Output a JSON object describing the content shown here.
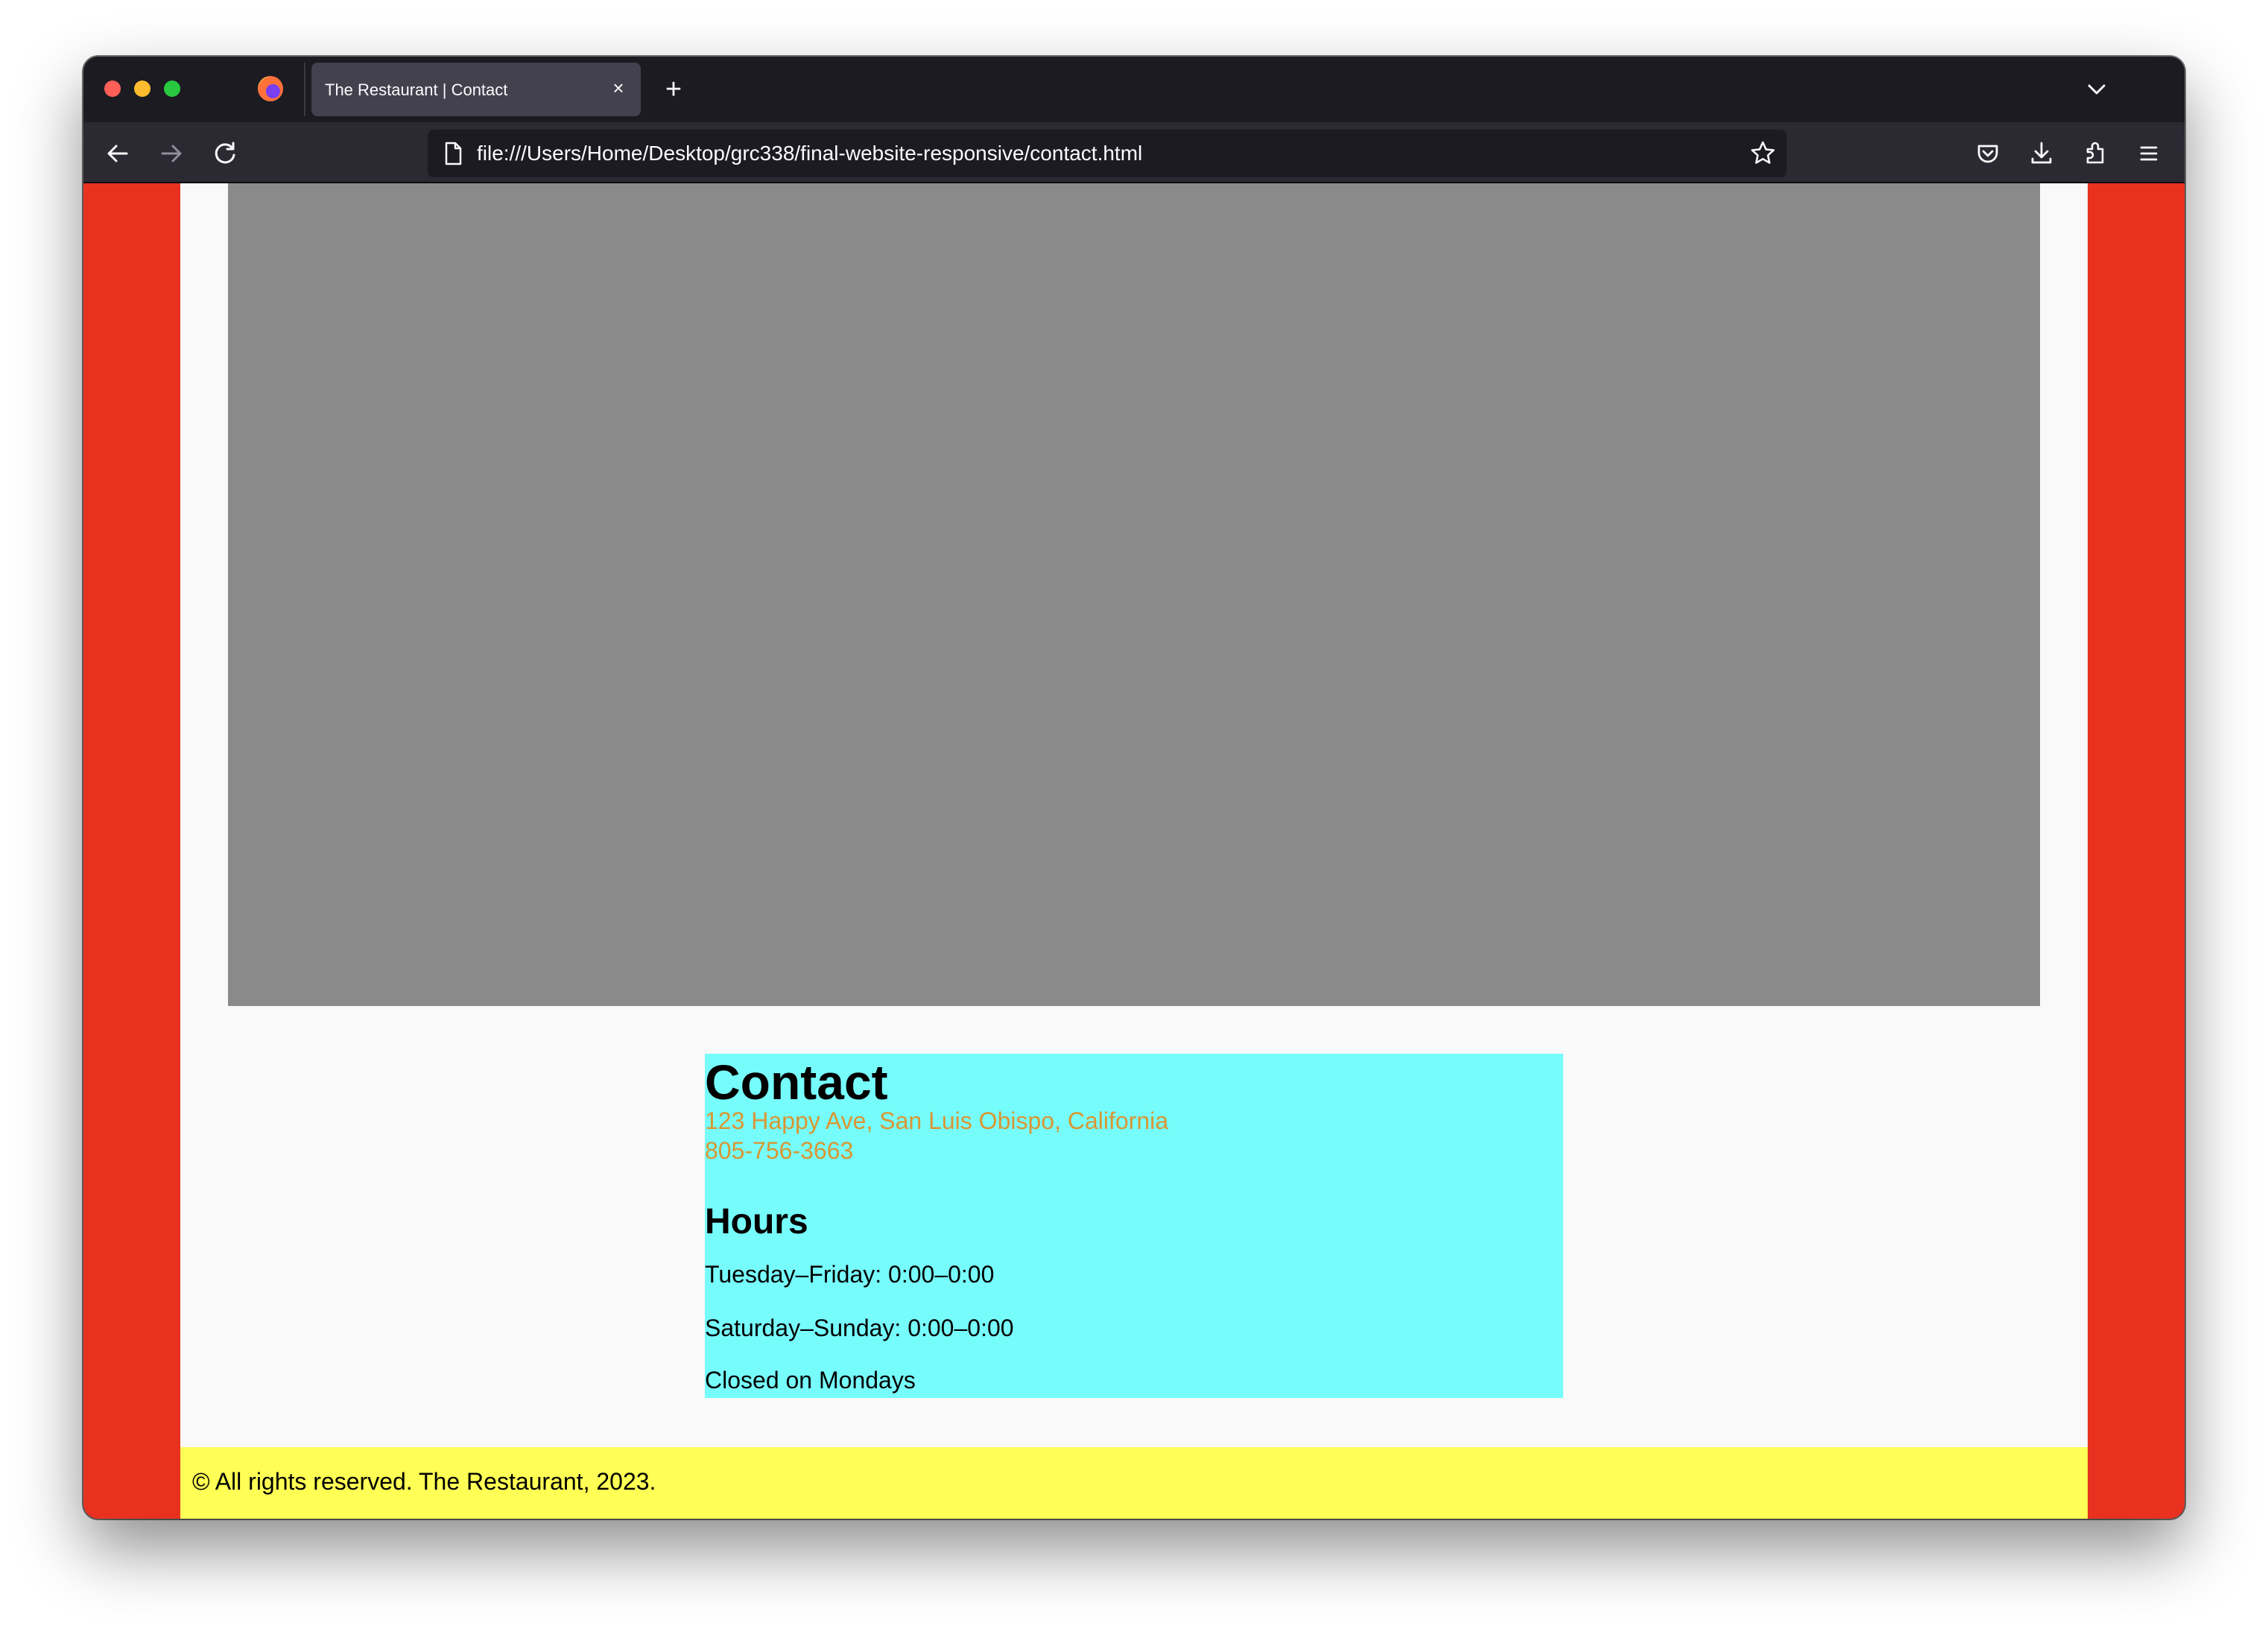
{
  "colors": {
    "traffic_red": "#ff5f57",
    "traffic_yellow": "#febc2e",
    "traffic_green": "#28c840",
    "page_background": "#e8321f",
    "content_background": "#f9f9f9",
    "map_placeholder": "#8a8a8a",
    "contact_box": "#77fcfc",
    "address_text": "#d99633",
    "footer": "#ffff55"
  },
  "browser": {
    "tab": {
      "title": "The Restaurant | Contact",
      "close_symbol": "×"
    },
    "new_tab_symbol": "+",
    "url": "file:///Users/Home/Desktop/grc338/final-website-responsive/contact.html",
    "forward_disabled": true,
    "icons": {
      "app": "firefox-icon",
      "back": "back-arrow-icon",
      "forward": "forward-arrow-icon",
      "reload": "reload-icon",
      "page": "page-icon",
      "bookmark": "star-icon",
      "pocket": "pocket-icon",
      "downloads": "download-icon",
      "extensions": "puzzle-icon",
      "menu": "hamburger-menu-icon",
      "tab_list": "chevron-down-icon"
    }
  },
  "contact": {
    "title": "Contact",
    "address": "123 Happy Ave, San Luis Obispo, California",
    "phone": "805-756-3663"
  },
  "hours": {
    "title": "Hours",
    "lines": [
      "Tuesday–Friday: 0:00–0:00",
      "Saturday–Sunday: 0:00–0:00",
      "Closed on Mondays"
    ]
  },
  "footer": {
    "text": "© All rights reserved. The Restaurant, 2023."
  }
}
